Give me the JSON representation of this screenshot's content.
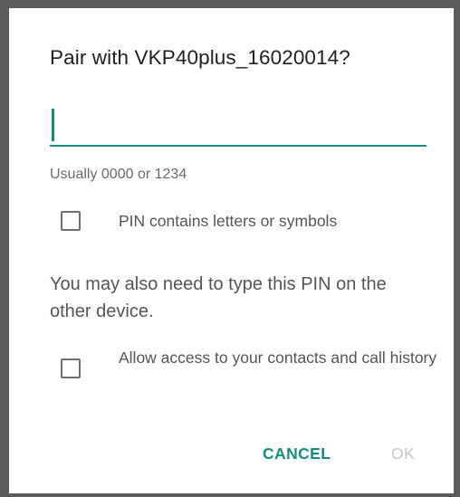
{
  "dialog": {
    "title": "Pair with VKP40plus_16020014?",
    "pin_input_value": "",
    "hint": "Usually 0000 or 1234",
    "pin_letters_checkbox_label": "PIN contains letters or symbols",
    "note": "You may also need to type this PIN on the other device.",
    "contacts_checkbox_label": "Allow access to your contacts and call history",
    "cancel_label": "CANCEL",
    "ok_label": "OK"
  },
  "colors": {
    "accent": "#138d7e",
    "disabled": "#c7c7c7"
  }
}
